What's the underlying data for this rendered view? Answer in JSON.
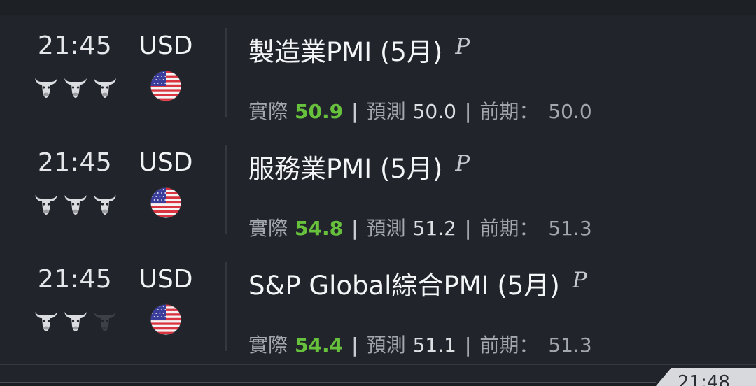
{
  "colors": {
    "background": "#21252b",
    "actual_green": "#67c13c",
    "bull_active": "#dadcdf",
    "bull_inactive": "#3d4147"
  },
  "labels": {
    "actual": "實際",
    "forecast": "預測",
    "previous": "前期：",
    "separator": "|",
    "preliminary_marker": "P"
  },
  "events": [
    {
      "time": "21:45",
      "currency": "USD",
      "flag_icon": "us-flag-icon",
      "importance": 3,
      "importance_max": 3,
      "title": "製造業PMI (5月)",
      "actual": "50.9",
      "forecast": "50.0",
      "previous": "50.0"
    },
    {
      "time": "21:45",
      "currency": "USD",
      "flag_icon": "us-flag-icon",
      "importance": 3,
      "importance_max": 3,
      "title": "服務業PMI (5月)",
      "actual": "54.8",
      "forecast": "51.2",
      "previous": "51.3"
    },
    {
      "time": "21:45",
      "currency": "USD",
      "flag_icon": "us-flag-icon",
      "importance": 2,
      "importance_max": 3,
      "title": "S&P Global綜合PMI (5月)",
      "actual": "54.4",
      "forecast": "51.1",
      "previous": "51.3"
    }
  ],
  "footer": {
    "time_tab": "21:48"
  }
}
